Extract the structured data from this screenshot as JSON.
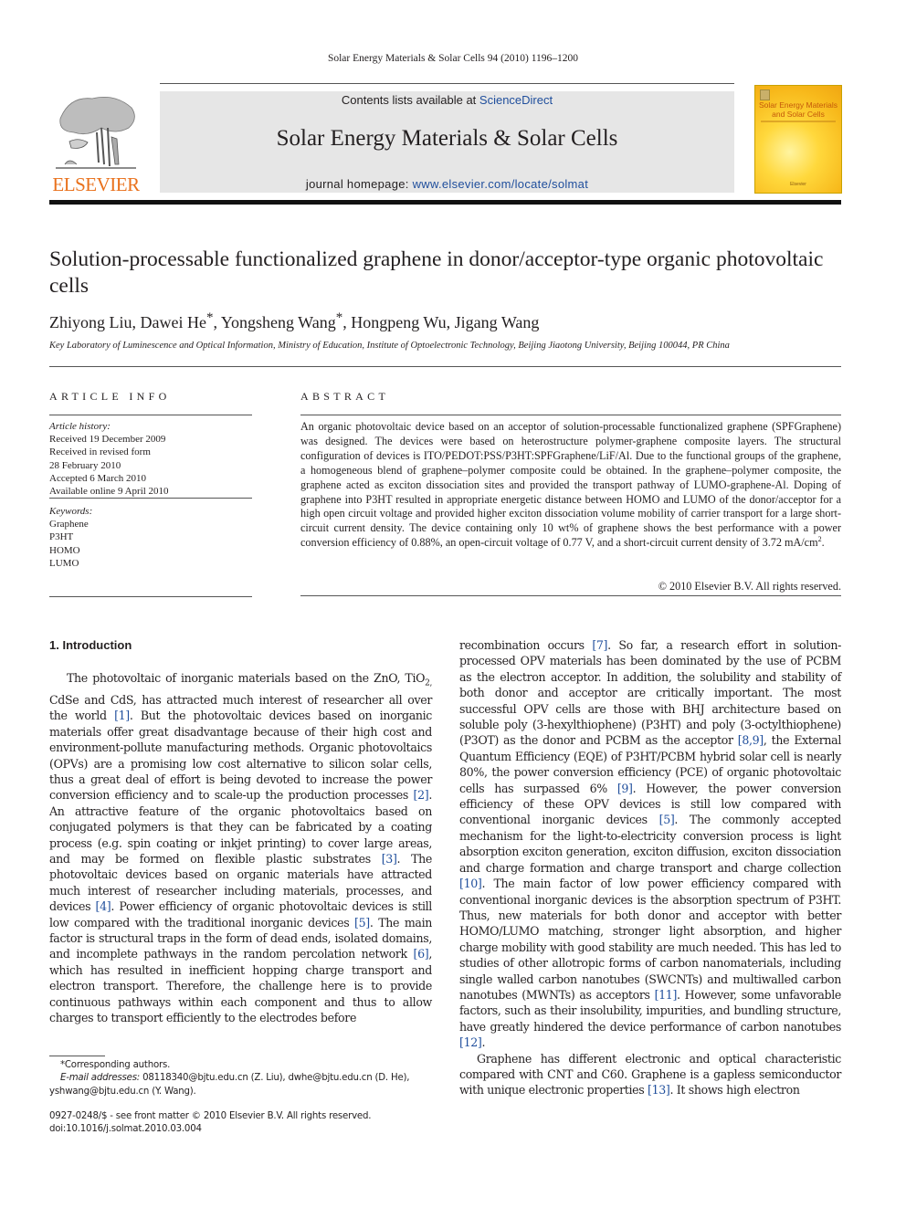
{
  "running_head": "Solar Energy Materials & Solar Cells 94 (2010) 1196–1200",
  "masthead": {
    "publisher_logo_text": "ELSEVIER",
    "contents_prefix": "Contents lists available at ",
    "contents_link": "ScienceDirect",
    "journal_name": "Solar Energy Materials & Solar Cells",
    "homepage_prefix": "journal homepage: ",
    "homepage_link": "www.elsevier.com/locate/solmat",
    "cover_title": "Solar Energy Materials and Solar Cells",
    "cover_publisher": "Elsevier",
    "accent_color": "#e9711c",
    "link_color": "#1f4e9c"
  },
  "article": {
    "title": "Solution-processable functionalized graphene in donor/acceptor-type organic photovoltaic cells",
    "authors": [
      {
        "name": "Zhiyong Liu",
        "corresponding": false
      },
      {
        "name": "Dawei He",
        "corresponding": true
      },
      {
        "name": "Yongsheng Wang",
        "corresponding": true
      },
      {
        "name": "Hongpeng Wu",
        "corresponding": false
      },
      {
        "name": "Jigang Wang",
        "corresponding": false
      }
    ],
    "authors_line": "Zhiyong Liu, Dawei He *, Yongsheng Wang *, Hongpeng Wu, Jigang Wang",
    "affiliation": "Key Laboratory of Luminescence and Optical Information, Ministry of Education, Institute of Optoelectronic Technology, Beijing Jiaotong University, Beijing 100044, PR China"
  },
  "article_info": {
    "heading": "ARTICLE INFO",
    "history_label": "Article history:",
    "history": [
      "Received 19 December 2009",
      "Received in revised form",
      "28 February 2010",
      "Accepted 6 March 2010",
      "Available online 9 April 2010"
    ],
    "keywords_label": "Keywords:",
    "keywords": [
      "Graphene",
      "P3HT",
      "HOMO",
      "LUMO"
    ]
  },
  "abstract": {
    "heading": "ABSTRACT",
    "text": "An organic photovoltaic device based on an acceptor of solution-processable functionalized graphene (SPFGraphene) was designed. The devices were based on heterostructure polymer-graphene composite layers. The structural configuration of devices is ITO/PEDOT:PSS/P3HT:SPFGraphene/LiF/Al. Due to the functional groups of the graphene, a homogeneous blend of graphene–polymer composite could be obtained. In the graphene–polymer composite, the graphene acted as exciton dissociation sites and provided the transport pathway of LUMO-graphene-Al. Doping of graphene into P3HT resulted in appropriate energetic distance between HOMO and LUMO of the donor/acceptor for a high open circuit voltage and provided higher exciton dissociation volume mobility of carrier transport for a large short-circuit current density. The device containing only 10 wt% of graphene shows the best performance with a power conversion efficiency of 0.88%, an open-circuit voltage of 0.77 V, and a short-circuit current density of 3.72 mA/cm",
    "text_sup": "2",
    "text_end": ".",
    "copyright": "© 2010 Elsevier B.V. All rights reserved."
  },
  "introduction": {
    "heading": "1.  Introduction",
    "left_p1": [
      {
        "t": "The photovoltaic of inorganic materials based on the ZnO, TiO"
      },
      {
        "sub": "2,"
      },
      {
        "t": " CdSe and CdS, has attracted much interest of researcher all over the world "
      },
      {
        "c": "[1]"
      },
      {
        "t": ". But the photovoltaic devices based on inorganic materials offer great disadvantage because of their high cost and environment-pollute manufacturing methods. Organic photovoltaics (OPVs) are a promising low cost alternative to silicon solar cells, thus a great deal of effort is being devoted to increase the power conversion efficiency and to scale-up the production processes "
      },
      {
        "c": "[2]"
      },
      {
        "t": ". An attractive feature of the organic photovoltaics based on conjugated polymers is that they can be fabricated by a coating process (e.g. spin coating or inkjet printing) to cover large areas, and may be formed on flexible plastic substrates "
      },
      {
        "c": "[3]"
      },
      {
        "t": ". The photovoltaic devices based on organic materials have attracted much interest of researcher including materials, processes, and devices "
      },
      {
        "c": "[4]"
      },
      {
        "t": ". Power efficiency of organic photovoltaic devices is still low compared with the traditional inorganic devices "
      },
      {
        "c": "[5]"
      },
      {
        "t": ". The main factor is structural traps in the form of dead ends, isolated domains, and incomplete pathways in the random percolation network "
      },
      {
        "c": "[6]"
      },
      {
        "t": ", which has resulted in inefficient hopping charge transport and electron transport. Therefore, the challenge here is to provide continuous pathways within each component and thus to allow charges to transport efficiently to the electrodes before"
      }
    ],
    "right_p1": [
      {
        "t": "recombination occurs "
      },
      {
        "c": "[7]"
      },
      {
        "t": ". So far, a research effort in solution-processed OPV materials has been dominated by the use of PCBM as the electron acceptor. In addition, the solubility and stability of both donor and acceptor are critically important. The most successful OPV cells are those with BHJ architecture based on soluble poly (3-hexylthiophene) (P3HT) and poly (3-octylthiophene) (P3OT) as the donor and PCBM as the acceptor "
      },
      {
        "c": "[8,9]"
      },
      {
        "t": ", the External Quantum Efficiency (EQE) of P3HT/PCBM hybrid solar cell is nearly 80%, the power conversion efficiency (PCE) of organic photovoltaic cells has surpassed 6% "
      },
      {
        "c": "[9]"
      },
      {
        "t": ". However, the power conversion efficiency of these OPV devices is still low compared with conventional inorganic devices "
      },
      {
        "c": "[5]"
      },
      {
        "t": ". The commonly accepted mechanism for the light-to-electricity conversion process is light absorption exciton generation, exciton diffusion, exciton dissociation and charge formation and charge transport and charge collection "
      },
      {
        "c": "[10]"
      },
      {
        "t": ". The main factor of low power efficiency compared with conventional inorganic devices is the absorption spectrum of P3HT. Thus, new materials for both donor and acceptor with better HOMO/LUMO matching, stronger light absorption, and higher charge mobility with good stability are much needed. This has led to studies of other allotropic forms of carbon nanomaterials, including single walled carbon nanotubes (SWCNTs) and multiwalled carbon nanotubes (MWNTs) as acceptors "
      },
      {
        "c": "[11]"
      },
      {
        "t": ". However, some unfavorable factors, such as their insolubility, impurities, and bundling structure, have greatly hindered the device performance of carbon nanotubes "
      },
      {
        "c": "[12]"
      },
      {
        "t": "."
      }
    ],
    "right_p2": [
      {
        "t": "Graphene has different electronic and optical characteristic compared with CNT and C60. Graphene is a gapless semiconductor with unique electronic properties "
      },
      {
        "c": "[13]"
      },
      {
        "t": ". It shows high electron"
      }
    ]
  },
  "footnote": {
    "corresponding": "*Corresponding authors.",
    "email_label": "E-mail addresses:",
    "emails": " 08118340@bjtu.edu.cn (Z. Liu), dwhe@bjtu.edu.cn (D. He), yshwang@bjtu.edu.cn (Y. Wang).",
    "front_matter": "0927-0248/$ - see front matter © 2010 Elsevier B.V. All rights reserved.",
    "doi": "doi:10.1016/j.solmat.2010.03.004"
  }
}
